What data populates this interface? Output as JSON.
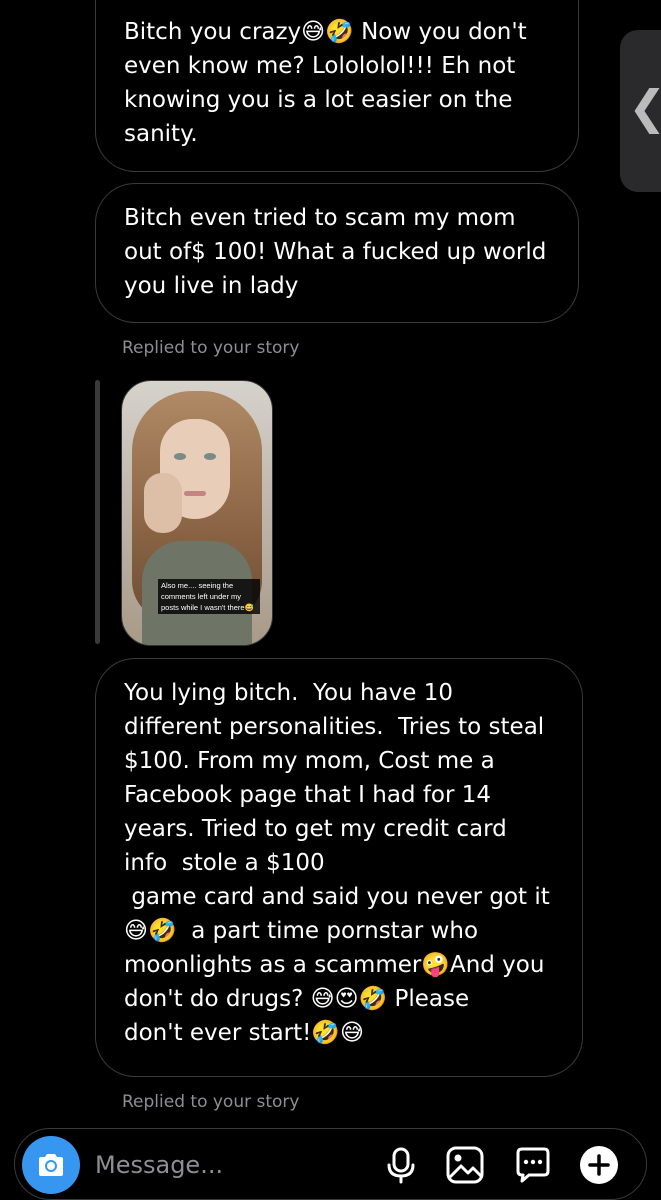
{
  "messages": [
    {
      "text": "Bitch you crazy😅🤣 Now you don't\neven know me? Lolololol!!! Eh not\nknowing you is a lot easier on the\nsanity."
    },
    {
      "text": "Bitch even tried to scam my mom\nout of$ 100! What a fucked up world\nyou live in lady"
    },
    {
      "text": "You lying bitch.  You have 10\ndifferent personalities.  Tries to steal\n$100. From my mom, Cost me a\nFacebook page that I had for 14\nyears. Tried to get my credit card\ninfo  stole a $100\n game card and said you never got it\n😅🤣  a part time pornstar who\nmoonlights as a scammer🤪And you\ndon't do drugs? 😅😍🤣 Please\ndon't ever start!🤣😅"
    }
  ],
  "replied_labels": [
    "Replied to your story",
    "Replied to your story"
  ],
  "story": {
    "caption": "Also me.... seeing the comments left under my posts while I wasn't there😅"
  },
  "side_handle": {
    "icon": "chevron-left-icon",
    "glyph": "❮"
  },
  "composer": {
    "placeholder": "Message...",
    "accent_color": "#3797f0",
    "icons": [
      "camera-icon",
      "microphone-icon",
      "image-icon",
      "sticker-icon",
      "plus-icon"
    ]
  }
}
